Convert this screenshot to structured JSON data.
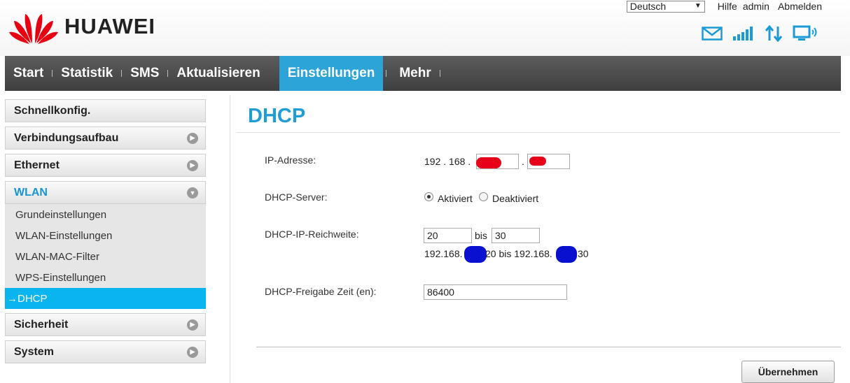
{
  "brand": {
    "name": "HUAWEI",
    "logo_icon": "huawei-petals-logo",
    "logo_color": "#e60012"
  },
  "header": {
    "language": "Deutsch",
    "links": {
      "help": "Hilfe",
      "user": "admin",
      "logout": "Abmelden"
    },
    "status_icons": [
      "mail-icon",
      "signal-icon",
      "transfer-icon",
      "connection-monitor-icon"
    ],
    "icon_color": "#1a9ad6"
  },
  "nav": {
    "items": [
      {
        "label": "Start"
      },
      {
        "label": "Statistik"
      },
      {
        "label": "SMS"
      },
      {
        "label": "Aktualisieren"
      },
      {
        "label": "Einstellungen",
        "active": true
      },
      {
        "label": "Mehr"
      }
    ],
    "active_color": "#2da4d8"
  },
  "sidebar": {
    "quick": "Schnellkonfig.",
    "connection": "Verbindungsaufbau",
    "ethernet": "Ethernet",
    "wlan": "WLAN",
    "wlan_items": [
      "Grundeinstellungen",
      "WLAN-Einstellungen",
      "WLAN-MAC-Filter",
      "WPS-Einstellungen"
    ],
    "dhcp": "→DHCP",
    "security": "Sicherheit",
    "system": "System"
  },
  "main": {
    "title": "DHCP",
    "ip": {
      "label": "IP-Adresse:",
      "prefix": "192 . 168 .",
      "dot": "."
    },
    "server": {
      "label": "DHCP-Server:",
      "on": "Aktiviert",
      "off": "Deaktiviert",
      "selected": "Aktiviert"
    },
    "range": {
      "label": "DHCP-IP-Reichweite:",
      "start": "20",
      "bis": "bis",
      "end": "30",
      "summary_a": "192.168.",
      "summary_b": "20 bis 192.168.",
      "summary_c": "30"
    },
    "lease": {
      "label": "DHCP-Freigabe Zeit (en):",
      "value": "86400"
    },
    "apply": "Übernehmen"
  }
}
